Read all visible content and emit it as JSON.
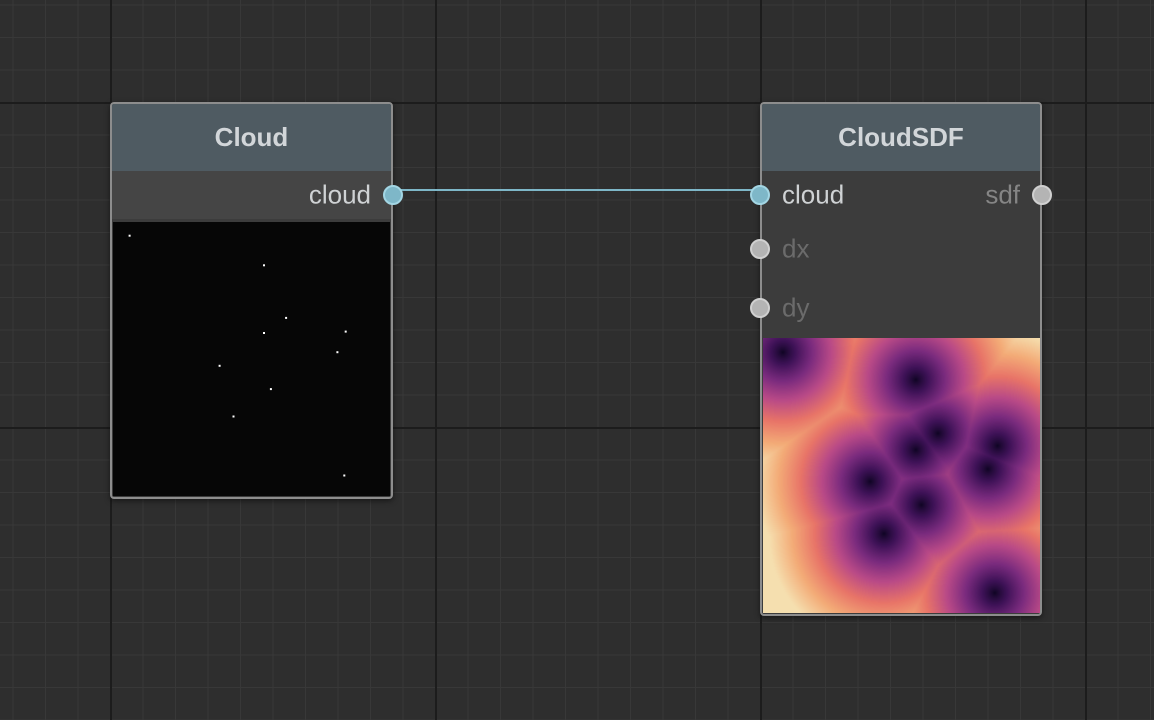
{
  "nodes": {
    "cloud": {
      "title": "Cloud",
      "output": {
        "label": "cloud",
        "port_state": "connected"
      },
      "preview": {
        "kind": "point-cloud",
        "background": "#060606",
        "point_color": "#ffffff",
        "points": [
          [
            0.06,
            0.05
          ],
          [
            0.545,
            0.158
          ],
          [
            0.625,
            0.35
          ],
          [
            0.545,
            0.405
          ],
          [
            0.84,
            0.4
          ],
          [
            0.81,
            0.475
          ],
          [
            0.385,
            0.525
          ],
          [
            0.57,
            0.61
          ],
          [
            0.435,
            0.71
          ],
          [
            0.835,
            0.925
          ]
        ]
      }
    },
    "cloudsdf": {
      "title": "CloudSDF",
      "inputs": [
        {
          "label": "cloud",
          "port_state": "connected",
          "label_style": "active"
        },
        {
          "label": "dx",
          "port_state": "idle",
          "label_style": "dim"
        },
        {
          "label": "dy",
          "port_state": "idle",
          "label_style": "dim"
        }
      ],
      "output": {
        "label": "sdf",
        "port_state": "idle",
        "label_style": "mid"
      },
      "preview": {
        "kind": "distance-field",
        "colormap": [
          "#0d0421",
          "#3e1257",
          "#7a2b7e",
          "#b94a87",
          "#e87468",
          "#f3ab77",
          "#f5dfaf"
        ],
        "centers": [
          [
            0.07,
            0.05
          ],
          [
            0.55,
            0.15
          ],
          [
            0.63,
            0.345
          ],
          [
            0.55,
            0.405
          ],
          [
            0.845,
            0.39
          ],
          [
            0.81,
            0.475
          ],
          [
            0.385,
            0.52
          ],
          [
            0.57,
            0.605
          ],
          [
            0.435,
            0.71
          ],
          [
            0.835,
            0.925
          ]
        ]
      }
    }
  },
  "connections": [
    {
      "from": "cloud.output.cloud",
      "to": "cloudsdf.input.cloud",
      "color": "#7eb7c8"
    }
  ]
}
